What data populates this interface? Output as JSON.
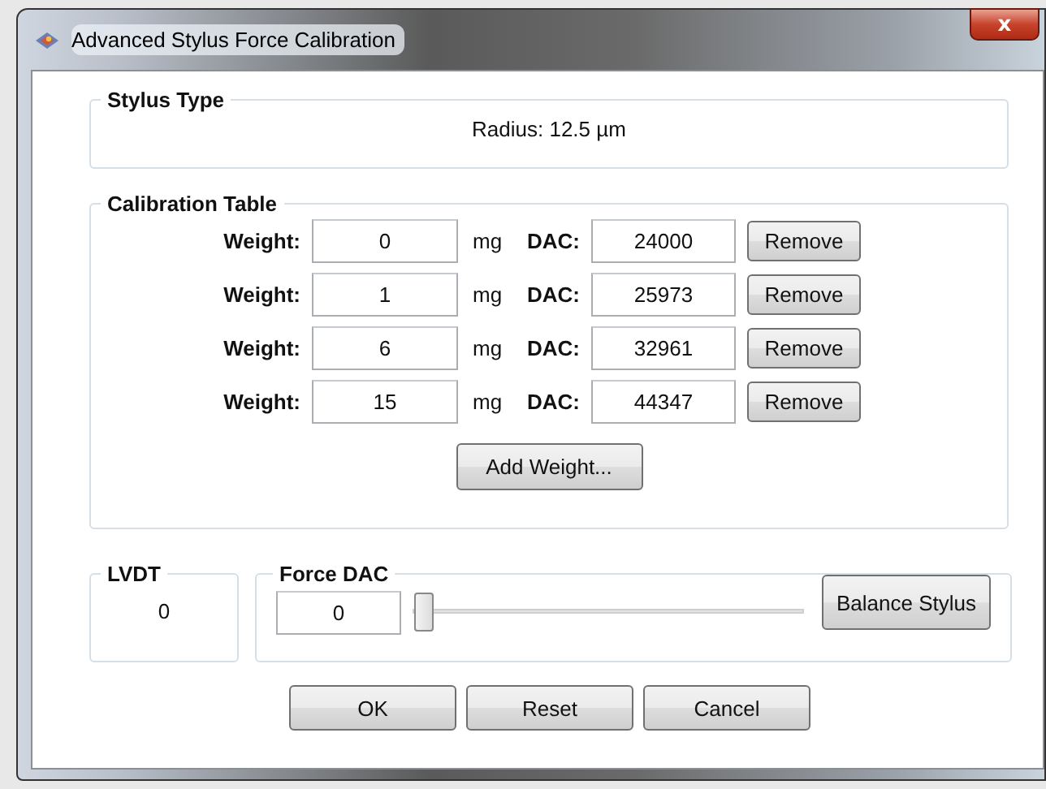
{
  "window": {
    "title": "Advanced Stylus Force Calibration",
    "close": "x"
  },
  "stylus_type": {
    "legend": "Stylus Type",
    "radius": "Radius: 12.5 µm"
  },
  "calibration_table": {
    "legend": "Calibration Table",
    "rows": [
      {
        "weight_label": "Weight:",
        "weight": "0",
        "unit": "mg",
        "dac_label": "DAC:",
        "dac": "24000",
        "remove": "Remove"
      },
      {
        "weight_label": "Weight:",
        "weight": "1",
        "unit": "mg",
        "dac_label": "DAC:",
        "dac": "25973",
        "remove": "Remove"
      },
      {
        "weight_label": "Weight:",
        "weight": "6",
        "unit": "mg",
        "dac_label": "DAC:",
        "dac": "32961",
        "remove": "Remove"
      },
      {
        "weight_label": "Weight:",
        "weight": "15",
        "unit": "mg",
        "dac_label": "DAC:",
        "dac": "44347",
        "remove": "Remove"
      }
    ],
    "add_button": "Add Weight..."
  },
  "lvdt": {
    "legend": "LVDT",
    "value": "0"
  },
  "force_dac": {
    "legend": "Force DAC",
    "value": "0",
    "level": 0,
    "button": "Balance Stylus"
  },
  "buttons": [
    "OK",
    "Reset",
    "Cancel"
  ]
}
